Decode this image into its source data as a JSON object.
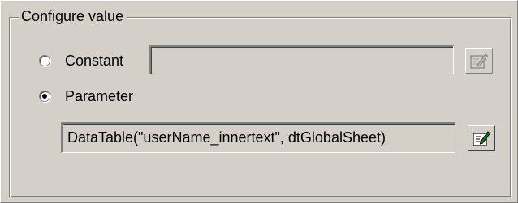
{
  "group": {
    "title": "Configure value"
  },
  "options": {
    "constant": {
      "label": "Constant",
      "selected": false,
      "value": ""
    },
    "parameter": {
      "label": "Parameter",
      "selected": true,
      "value": "DataTable(\"userName_innertext\", dtGlobalSheet)"
    }
  },
  "icons": {
    "constant_button_icon": "edit-document-icon",
    "parameter_button_icon": "edit-document-icon"
  },
  "colors": {
    "face": "#d4d0c8",
    "shadow": "#808080",
    "highlight": "#ffffff",
    "text": "#000000",
    "disabled_text": "#808080",
    "pencil_green": "#008000"
  }
}
